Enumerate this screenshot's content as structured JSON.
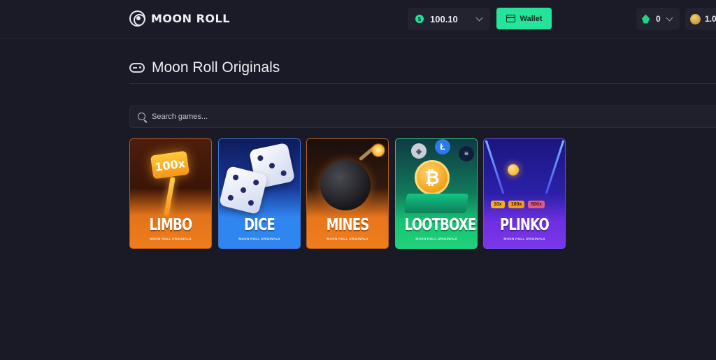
{
  "header": {
    "brand": "MOON ROLL",
    "balance": "100.10",
    "wallet_label": "Wallet",
    "gems": "0",
    "coins": "1.0"
  },
  "section": {
    "title": "Moon Roll Originals"
  },
  "search": {
    "placeholder": "Search games..."
  },
  "games": [
    {
      "name": "LIMBO",
      "subtitle": "MOON ROLL ORIGINALS",
      "badge": "100x"
    },
    {
      "name": "DICE",
      "subtitle": "MOON ROLL ORIGINALS"
    },
    {
      "name": "MINES",
      "subtitle": "MOON ROLL ORIGINALS"
    },
    {
      "name": "LOOTBOXES",
      "subtitle": "MOON ROLL ORIGINALS"
    },
    {
      "name": "PLINKO",
      "subtitle": "MOON ROLL ORIGINALS",
      "multipliers": [
        "10x",
        "100x",
        "500x"
      ]
    }
  ],
  "colors": {
    "background": "#191a25",
    "accent": "#24e49b",
    "limbo": "#f07d1c",
    "dice": "#2f86f0",
    "mines": "#f07d1c",
    "lootboxes": "#1fd27a",
    "plinko": "#7a36ea"
  }
}
